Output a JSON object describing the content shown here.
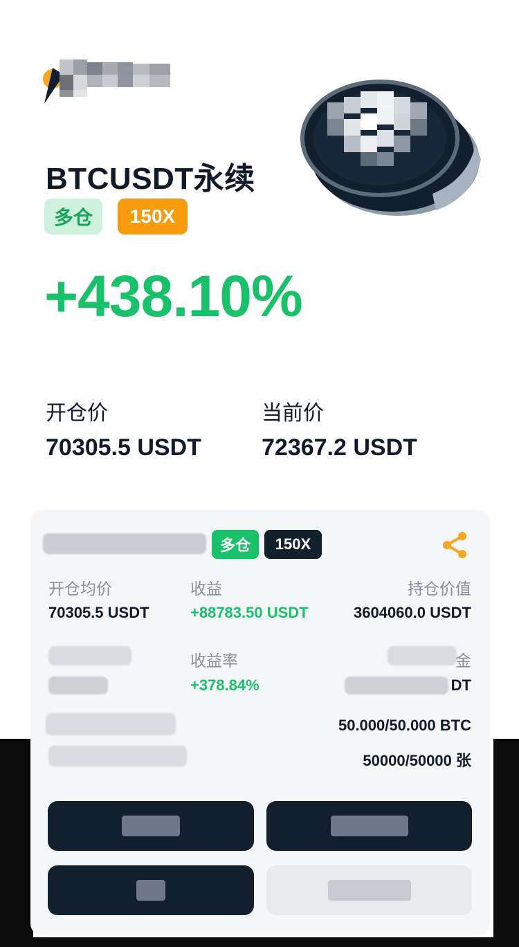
{
  "header": {
    "pair": "BTCUSDT永续",
    "side_badge": "多仓",
    "leverage_badge": "150X",
    "pnl_percent": "+438.10%"
  },
  "prices": {
    "open_label": "开仓价",
    "open_value": "70305.5  USDT",
    "current_label": "当前价",
    "current_value": "72367.2  USDT"
  },
  "card": {
    "side_badge": "多仓",
    "leverage_badge": "150X",
    "avg_open_label": "开仓均价",
    "avg_open_value": "70305.5  USDT",
    "profit_label": "收益",
    "profit_value": "+88783.50  USDT",
    "position_value_label": "持仓价值",
    "position_value_value": "3604060.0  USDT",
    "roi_label": "收益率",
    "roi_value": "+378.84%",
    "partial_right_value_tail": "DT",
    "partial_right_label_tail": "金",
    "size_btc": "50.000/50.000 BTC",
    "size_contracts": "50000/50000 张"
  },
  "colors": {
    "accent_green": "#19c16a",
    "badge_orange": "#f59b0c",
    "dark": "#12202e"
  },
  "icons": {
    "share": "share-icon"
  }
}
